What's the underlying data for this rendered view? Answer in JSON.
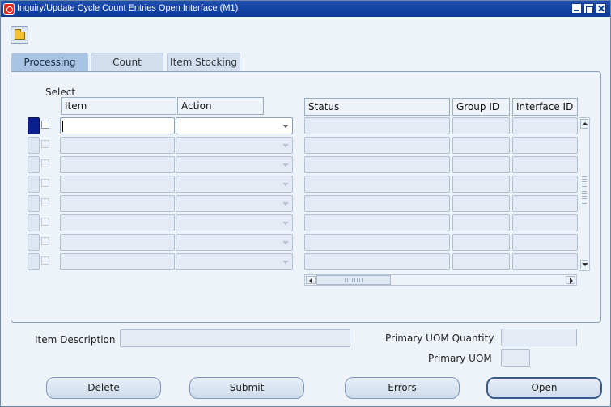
{
  "window": {
    "title": "Inquiry/Update Cycle Count Entries Open Interface (M1)"
  },
  "tabs": [
    {
      "label": "Processing",
      "active": true
    },
    {
      "label": "Count",
      "active": false
    },
    {
      "label": "Item Stocking",
      "active": false
    }
  ],
  "grid": {
    "select_label": "Select",
    "columns": {
      "item": "Item",
      "action": "Action",
      "status": "Status",
      "group_id": "Group ID",
      "interface_id": "Interface ID"
    },
    "row_count": 8,
    "current_row": 1
  },
  "fields": {
    "item_description_label": "Item Description",
    "item_description_value": "",
    "primary_uom_quantity_label": "Primary UOM Quantity",
    "primary_uom_quantity_value": "",
    "primary_uom_label": "Primary UOM",
    "primary_uom_value": ""
  },
  "buttons": {
    "delete": {
      "mnemonic": "D",
      "rest": "elete"
    },
    "submit": {
      "mnemonic": "S",
      "rest": "ubmit"
    },
    "errors": {
      "pre": "E",
      "mnemonic": "r",
      "rest": "rors"
    },
    "open": {
      "mnemonic": "O",
      "rest": "pen"
    }
  },
  "colors": {
    "titlebar": "#0b3a96",
    "current_row_marker": "#0b1f8f",
    "tab_active": "#a9c4e2"
  },
  "icons": [
    "app-icon",
    "minimize-icon",
    "maximize-icon",
    "close-icon",
    "open-folder-icon",
    "dropdown-arrow-icon"
  ]
}
